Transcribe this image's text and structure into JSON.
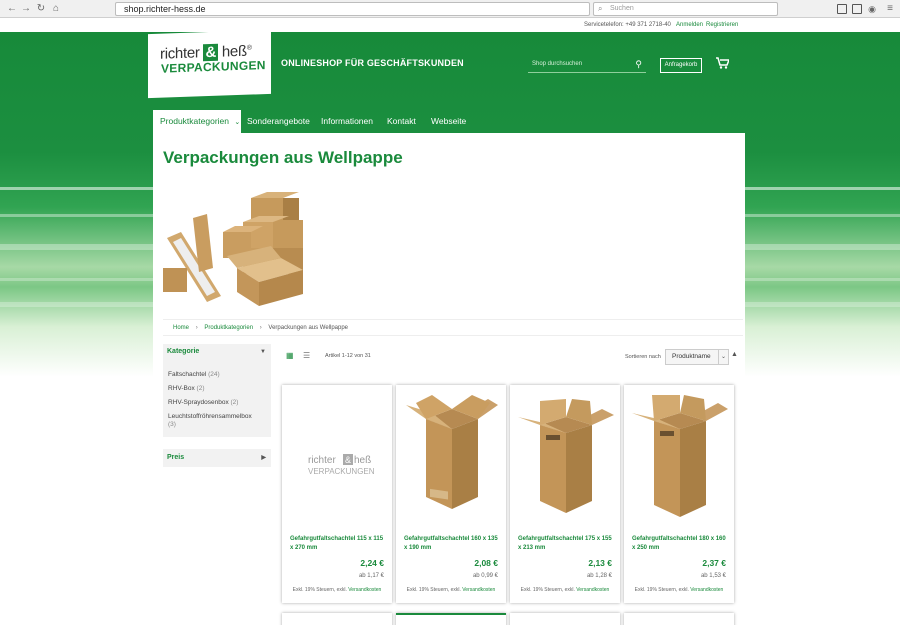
{
  "browser": {
    "url": "shop.richter-hess.de",
    "search_placeholder": "Suchen"
  },
  "topbar": {
    "phone": "Servicetelefon: +49 371 2718-40",
    "login": "Anmelden",
    "register": "Registrieren"
  },
  "header": {
    "logo_line1_a": "richter",
    "logo_amp": "&",
    "logo_line1_b": "heß",
    "logo_reg": "®",
    "logo_line2": "VERPACKUNGEN",
    "tagline": "ONLINESHOP FÜR GESCHÄFTSKUNDEN",
    "search_placeholder": "Shop durchsuchen",
    "inquiry_label": "Anfragekorb"
  },
  "nav": {
    "items": [
      {
        "label": "Produktkategorien"
      },
      {
        "label": "Sonderangebote"
      },
      {
        "label": "Informationen"
      },
      {
        "label": "Kontakt"
      },
      {
        "label": "Webseite"
      }
    ]
  },
  "page": {
    "title": "Verpackungen aus Wellpappe",
    "breadcrumb": [
      "Home",
      "Produktkategorien",
      "Verpackungen aus Wellpappe"
    ]
  },
  "sidebar": {
    "category_title": "Kategorie",
    "categories": [
      {
        "name": "Faltschachtel",
        "count": "(24)"
      },
      {
        "name": "RHV-Box",
        "count": "(2)"
      },
      {
        "name": "RHV-Spraydosenbox",
        "count": "(2)"
      },
      {
        "name": "Leuchtstoffröhrensammelbox",
        "count": "(3)"
      }
    ],
    "price_title": "Preis"
  },
  "toolbar": {
    "amount": "Artikel 1-12 von 31",
    "sort_label": "Sortieren nach",
    "sort_value": "Produktname"
  },
  "products": [
    {
      "name": "Gefahrgutfaltschachtel 115 x 115 x 270 mm",
      "price": "2,24 €",
      "from": "ab 1,17 €",
      "tax": "Exkl. 19% Steuern, exkl.",
      "ship": "Versandkosten"
    },
    {
      "name": "Gefahrgutfaltschachtel 160 x 135 x 190 mm",
      "price": "2,08 €",
      "from": "ab 0,99 €",
      "tax": "Exkl. 19% Steuern, exkl.",
      "ship": "Versandkosten"
    },
    {
      "name": "Gefahrgutfaltschachtel 175 x 155 x 213 mm",
      "price": "2,13 €",
      "from": "ab 1,28 €",
      "tax": "Exkl. 19% Steuern, exkl.",
      "ship": "Versandkosten"
    },
    {
      "name": "Gefahrgutfaltschachtel 180 x 160 x 250 mm",
      "price": "2,37 €",
      "from": "ab 1,53 €",
      "tax": "Exkl. 19% Steuern, exkl.",
      "ship": "Versandkosten"
    }
  ],
  "colors": {
    "brand_green": "#1a8a3c",
    "cardboard": "#c9a36b"
  }
}
